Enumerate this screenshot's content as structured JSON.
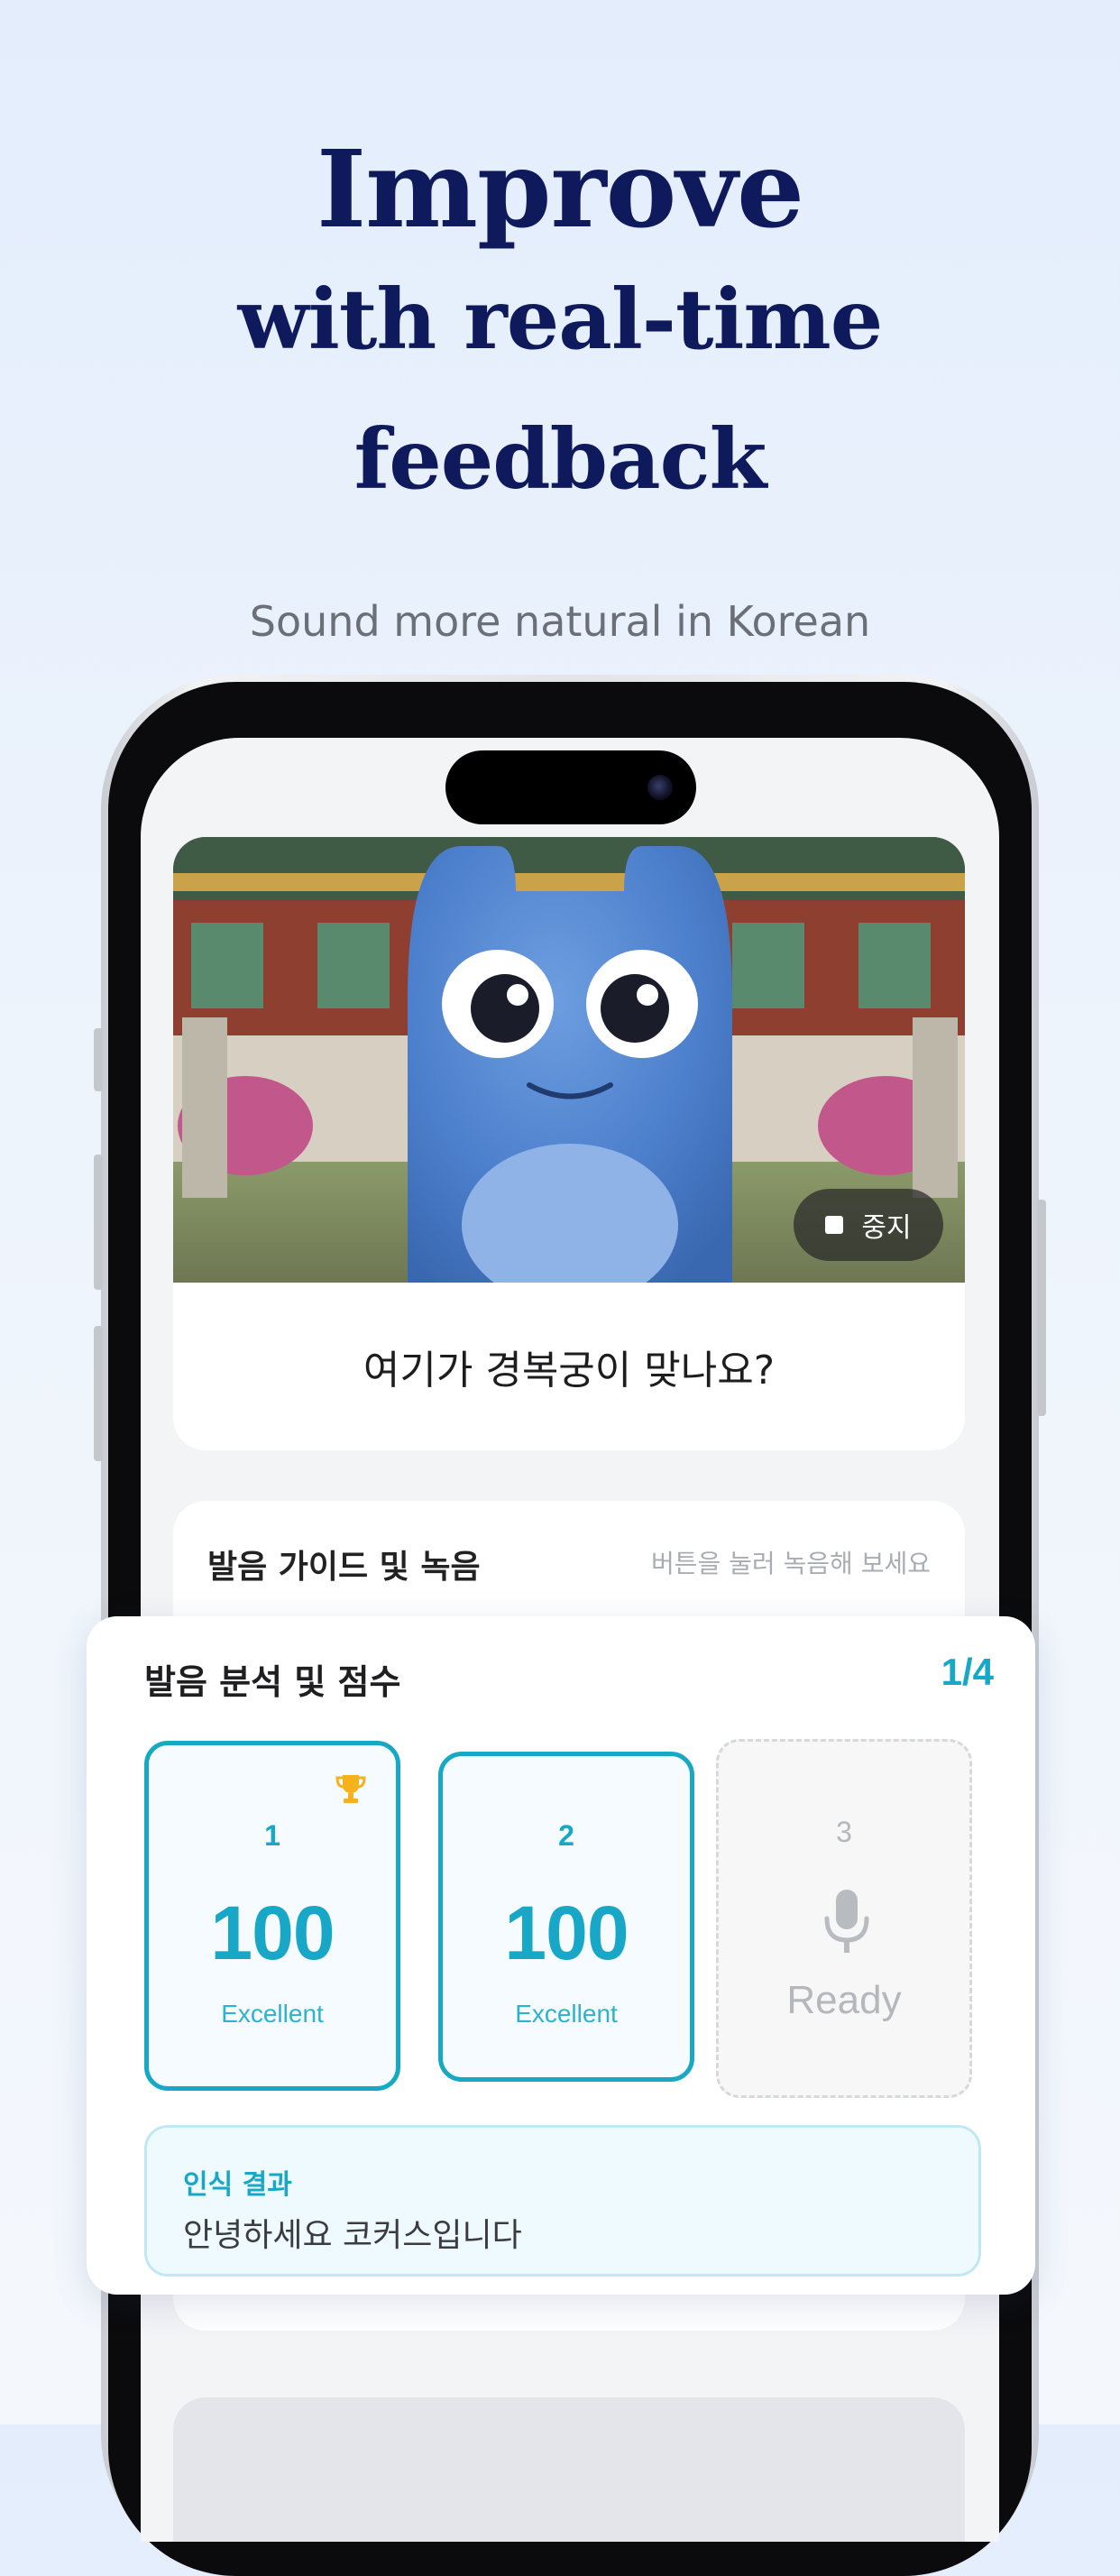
{
  "headline": {
    "line1": "Improve",
    "line2": "with real-time",
    "line3": "feedback",
    "subtitle": "Sound more natural in Korean"
  },
  "lesson": {
    "stop_label": "중지",
    "sentence": "여기가 경복궁이 맞나요?"
  },
  "guide": {
    "title": "발음 가이드 및 녹음",
    "hint": "버튼을 눌러 녹음해 보세요"
  },
  "analysis": {
    "title": "발음 분석 및 점수",
    "counter": "1/4",
    "attempts": [
      {
        "number": "1",
        "score": "100",
        "label": "Excellent",
        "state": "done",
        "icon": "trophy-icon"
      },
      {
        "number": "2",
        "score": "100",
        "label": "Excellent",
        "state": "done"
      },
      {
        "number": "3",
        "label": "Ready",
        "state": "ready",
        "icon": "microphone-icon"
      }
    ],
    "result_label": "인식 결과",
    "result_text": "안녕하세요 코커스입니다"
  },
  "colors": {
    "accent": "#19a7c7",
    "headline": "#0e1a5c",
    "background": "#e3edfc"
  }
}
